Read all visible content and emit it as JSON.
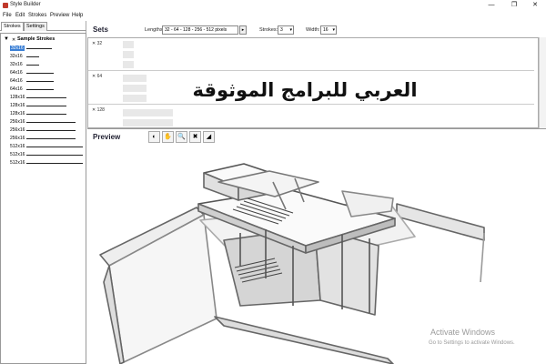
{
  "window": {
    "title": "Style Builder",
    "minimize_glyph": "—",
    "maximize_glyph": "❐",
    "close_glyph": "✕"
  },
  "menu": [
    "File",
    "Edit",
    "Strokes",
    "Preview",
    "Help"
  ],
  "left_tabs": [
    "Strokes",
    "Settings"
  ],
  "tree": {
    "root_label": "Sample Strokes",
    "items": [
      {
        "label": "32x16",
        "selected": true
      },
      {
        "label": "32x16"
      },
      {
        "label": "32x16"
      },
      {
        "label": "64x16"
      },
      {
        "label": "64x16"
      },
      {
        "label": "64x16"
      },
      {
        "label": "128x16"
      },
      {
        "label": "128x16"
      },
      {
        "label": "128x16"
      },
      {
        "label": "256x16"
      },
      {
        "label": "256x16"
      },
      {
        "label": "256x16"
      },
      {
        "label": "512x16"
      },
      {
        "label": "512x16"
      },
      {
        "label": "512x16"
      }
    ]
  },
  "sets": {
    "title": "Sets",
    "lengths_label": "Lengths:",
    "lengths_value": "32 - 64 - 128 - 256 - 512 pixels",
    "lengths_btn": "▸",
    "strokes_label": "Strokes:",
    "strokes_value": "3",
    "width_label": "Width:",
    "width_value": "16",
    "rows": [
      "32",
      "64",
      "128"
    ]
  },
  "overlay_text": "العربي للبرامج الموثوقة",
  "preview": {
    "title": "Preview",
    "tools": [
      {
        "icon": "orbit-icon",
        "glyph": "◐"
      },
      {
        "icon": "pan-icon",
        "glyph": "✋"
      },
      {
        "icon": "zoom-icon",
        "glyph": "🔍"
      },
      {
        "icon": "close-x-icon",
        "glyph": "✖"
      },
      {
        "icon": "eraser-icon",
        "glyph": "◢"
      }
    ]
  },
  "watermark": {
    "title": "Activate Windows",
    "subtitle": "Go to Settings to activate Windows."
  }
}
